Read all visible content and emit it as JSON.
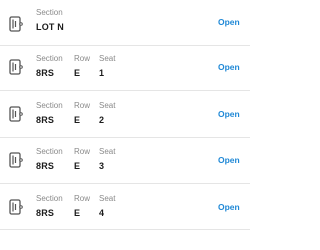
{
  "tickets": [
    {
      "section_label": "Section",
      "section": "LOT N",
      "action_label": "Open"
    },
    {
      "section_label": "Section",
      "section": "8RS",
      "row_label": "Row",
      "row": "E",
      "seat_label": "Seat",
      "seat": "1",
      "action_label": "Open"
    },
    {
      "section_label": "Section",
      "section": "8RS",
      "row_label": "Row",
      "row": "E",
      "seat_label": "Seat",
      "seat": "2",
      "action_label": "Open"
    },
    {
      "section_label": "Section",
      "section": "8RS",
      "row_label": "Row",
      "row": "E",
      "seat_label": "Seat",
      "seat": "3",
      "action_label": "Open"
    },
    {
      "section_label": "Section",
      "section": "8RS",
      "row_label": "Row",
      "row": "E",
      "seat_label": "Seat",
      "seat": "4",
      "action_label": "Open"
    }
  ],
  "icons": {
    "ticket": "ticket-icon"
  },
  "colors": {
    "link": "#1f88d6",
    "label": "#8a8a8a",
    "value": "#1c1c1c",
    "divider": "#e5e5e5"
  }
}
